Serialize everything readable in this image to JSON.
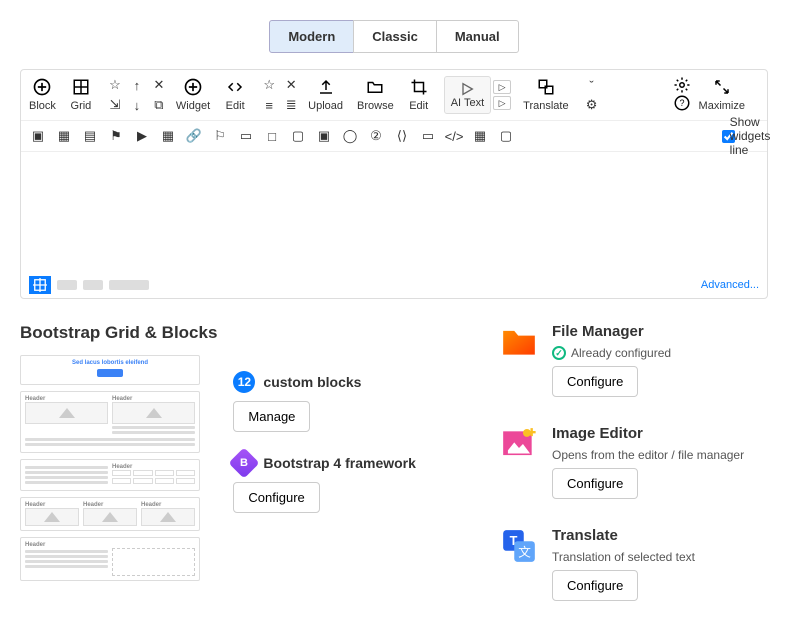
{
  "tabs": {
    "modern": "Modern",
    "classic": "Classic",
    "manual": "Manual"
  },
  "toolbar": {
    "block": "Block",
    "grid": "Grid",
    "widget": "Widget",
    "edit": "Edit",
    "upload": "Upload",
    "browse": "Browse",
    "edit2": "Edit",
    "aitext": "AI Text",
    "translate": "Translate",
    "maximize": "Maximize"
  },
  "status": {
    "advanced": "Advanced..."
  },
  "showWidgets": "Show widgets line",
  "grid_section": {
    "title": "Bootstrap Grid & Blocks",
    "customBlocksCount": "12",
    "customBlocksLabel": "custom blocks",
    "manage": "Manage",
    "bootstrapLabel": "Bootstrap 4 framework",
    "configure": "Configure"
  },
  "services": {
    "file": {
      "title": "File Manager",
      "sub": "Already configured",
      "btn": "Configure"
    },
    "image": {
      "title": "Image Editor",
      "sub": "Opens from the editor / file manager",
      "btn": "Configure"
    },
    "translate": {
      "title": "Translate",
      "sub": "Translation of selected text",
      "btn": "Configure"
    }
  }
}
